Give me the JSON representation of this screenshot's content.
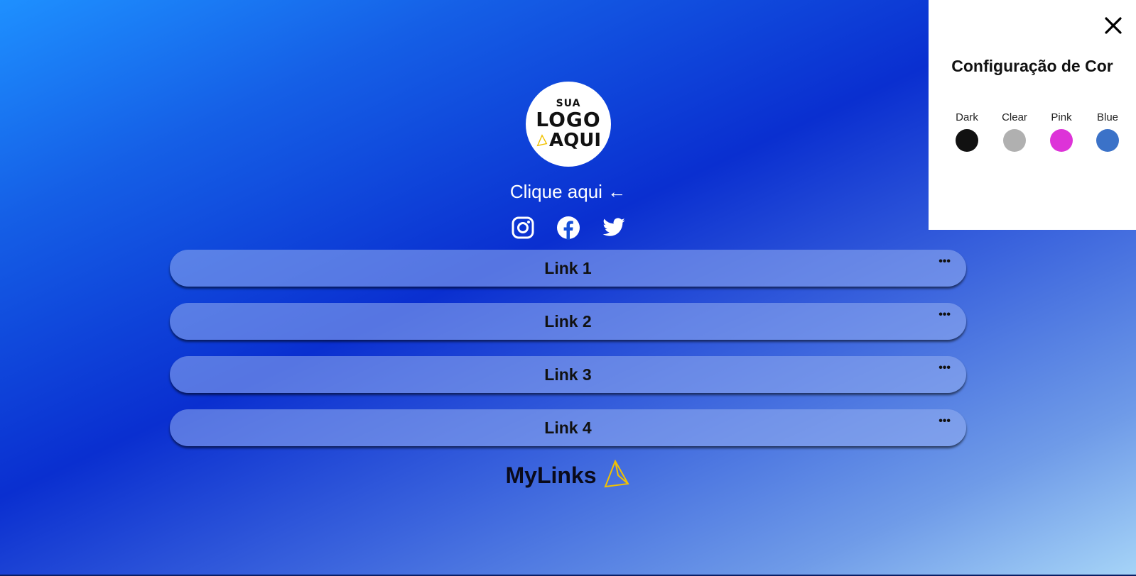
{
  "logo": {
    "line1": "SUA",
    "line2": "LOGO",
    "line3": "AQUI"
  },
  "profile": {
    "cta": "Clique aqui ←"
  },
  "socials": [
    {
      "icon": "instagram-icon"
    },
    {
      "icon": "facebook-icon"
    },
    {
      "icon": "twitter-icon"
    }
  ],
  "links": [
    {
      "label": "Link 1",
      "menu": "•••"
    },
    {
      "label": "Link 2",
      "menu": "•••"
    },
    {
      "label": "Link 3",
      "menu": "•••"
    },
    {
      "label": "Link 4",
      "menu": "•••"
    }
  ],
  "footer": {
    "brand": "MyLinks",
    "accent": "#f2c200"
  },
  "color_panel": {
    "title": "Configuração de Cor",
    "close_icon": "close-icon",
    "options": [
      {
        "label": "Dark",
        "color": "#111111"
      },
      {
        "label": "Clear",
        "color": "#b0b0b0"
      },
      {
        "label": "Pink",
        "color": "#dd33d8"
      },
      {
        "label": "Blue",
        "color": "#3b72c8"
      }
    ]
  }
}
